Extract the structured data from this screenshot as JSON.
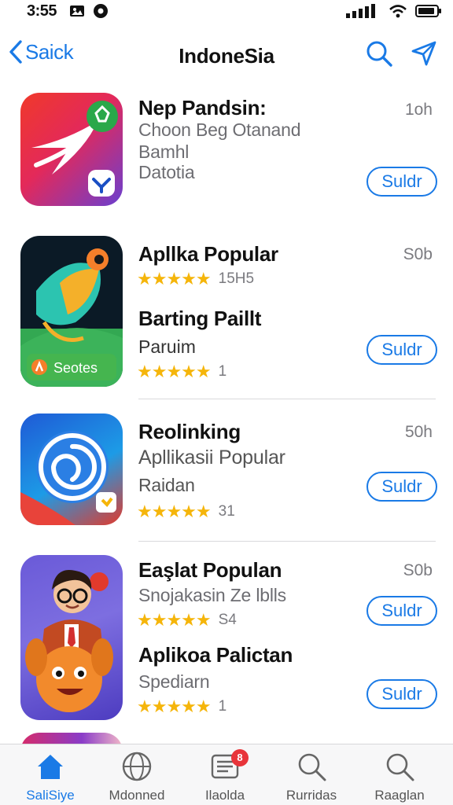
{
  "status_bar": {
    "time": "3:55"
  },
  "nav": {
    "back_label": "Saick",
    "title": "IndoneSia"
  },
  "apps": [
    {
      "title": "Nep Pandsin:",
      "subtitle": "Choon Beg Otanand",
      "line3": "Bamhl",
      "line4": "Datotia",
      "time": "1oh",
      "button": "Suldr"
    },
    {
      "title": "Apllka Popular",
      "rating_count": "15H5",
      "title2": "Barting Paillt",
      "line3": "Paruim",
      "rating_count2": "1",
      "time": "S0b",
      "button": "Suldr",
      "icon_badge_text": "Seotes"
    },
    {
      "title": "Reolinking",
      "subtitle": "Apllikasii Popular",
      "line3": "Raidan",
      "rating_count": "31",
      "time": "50h",
      "button": "Suldr"
    },
    {
      "title": "Eaşlat Populan",
      "subtitle": "Snojakasin Ze lblls",
      "rating_count": "S4",
      "title2": "Aplikoa Palictan",
      "line3": "Spediarn",
      "rating_count2": "1",
      "time": "S0b",
      "button": "Suldr",
      "button2": "Suldr"
    }
  ],
  "tabs": [
    {
      "label": "SaliSiye",
      "icon": "home-icon"
    },
    {
      "label": "Mdonned",
      "icon": "globe-icon"
    },
    {
      "label": "Ilaolda",
      "icon": "updates-icon",
      "badge": "8"
    },
    {
      "label": "Rurridas",
      "icon": "search-icon"
    },
    {
      "label": "Raaglan",
      "icon": "search-icon"
    }
  ],
  "colors": {
    "accent": "#1a7ae6",
    "star": "#f5b50a",
    "badge": "#e8343a"
  }
}
